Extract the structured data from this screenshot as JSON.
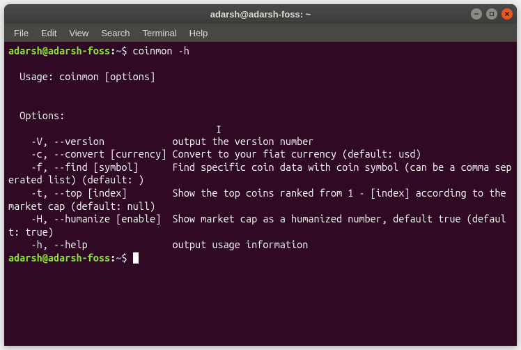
{
  "titlebar": {
    "title": "adarsh@adarsh-foss: ~"
  },
  "menubar": {
    "items": [
      "File",
      "Edit",
      "View",
      "Search",
      "Terminal",
      "Help"
    ]
  },
  "terminal": {
    "prompt1": {
      "user": "adarsh@adarsh-foss",
      "path": "~",
      "command": "coinmon -h"
    },
    "output": {
      "usage": "  Usage: coinmon [options]",
      "options_header": "  Options:",
      "opt1": "    -V, --version            output the version number",
      "opt2": "    -c, --convert [currency] Convert to your fiat currency (default: usd)",
      "opt3": "    -f, --find [symbol]      Find specific coin data with coin symbol (can be a comma seperated list) (default: )",
      "opt4": "    -t, --top [index]        Show the top coins ranked from 1 - [index] according to the market cap (default: null)",
      "opt5": "    -H, --humanize [enable]  Show market cap as a humanized number, default true (default: true)",
      "opt6": "    -h, --help               output usage information"
    },
    "prompt2": {
      "user": "adarsh@adarsh-foss",
      "path": "~"
    }
  }
}
